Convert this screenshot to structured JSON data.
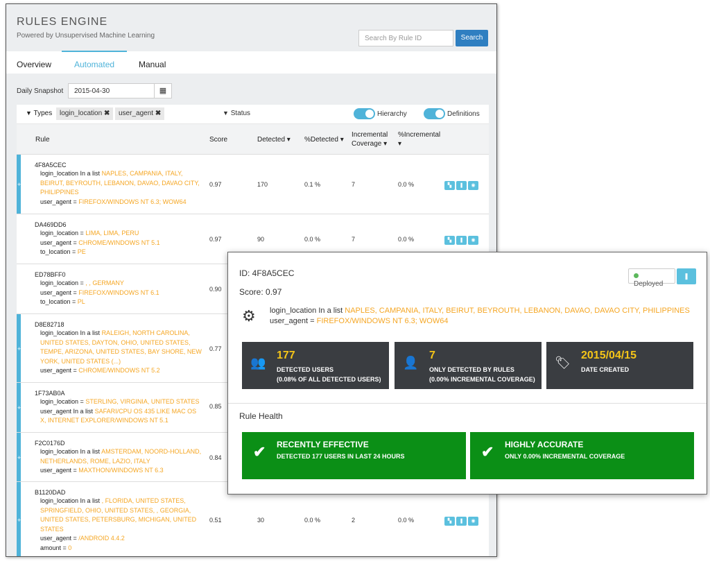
{
  "header": {
    "title": "RULES ENGINE",
    "subtitle": "Powered by Unsupervised Machine Learning",
    "search_placeholder": "Search By Rule ID",
    "search_button": "Search"
  },
  "tabs": [
    "Overview",
    "Automated",
    "Manual"
  ],
  "snapshot": {
    "label": "Daily Snapshot",
    "date": "2015-04-30"
  },
  "filters": {
    "types_label": "Types",
    "chips": [
      "login_location",
      "user_agent"
    ],
    "status_label": "Status",
    "toggle1": "Hierarchy",
    "toggle2": "Definitions"
  },
  "columns": {
    "rule": "Rule",
    "score": "Score",
    "detected": "Detected",
    "pct_detected": "%Detected",
    "inc_cov_1": "Incremental",
    "inc_cov_2": "Coverage",
    "pct_inc": "%Incremental"
  },
  "rows": [
    {
      "id": "4F8A5CEC",
      "score": "0.97",
      "detected": "170",
      "pct": "0.1 %",
      "inc": "7",
      "pinc": "0.0 %"
    },
    {
      "id": "DA469DD6",
      "score": "0.97",
      "detected": "90",
      "pct": "0.0 %",
      "inc": "7",
      "pinc": "0.0 %"
    },
    {
      "id": "ED78BFF0",
      "score": "0.90"
    },
    {
      "id": "D8E82718",
      "score": "0.77"
    },
    {
      "id": "1F73AB0A",
      "score": "0.85"
    },
    {
      "id": "F2C0176D",
      "score": "0.84"
    },
    {
      "id": "B1120DAD",
      "score": "0.51",
      "detected": "30",
      "pct": "0.0 %",
      "inc": "2",
      "pinc": "0.0 %"
    }
  ],
  "popup": {
    "id": "ID: 4F8A5CEC",
    "score": "Score: 0.97",
    "deployed": "Deployed",
    "cond1_key": "login_location",
    "cond1_op": "In a list",
    "cond1_val": "NAPLES, CAMPANIA, ITALY, BEIRUT, BEYROUTH, LEBANON, DAVAO, DAVAO CITY, PHILIPPINES",
    "cond2_key": "user_agent",
    "cond2_op": "=",
    "cond2_val": "FIREFOX/WINDOWS NT 6.3; WOW64",
    "stats": [
      {
        "num": "177",
        "l1": "DETECTED USERS",
        "l2": "(0.08% OF ALL DETECTED USERS)"
      },
      {
        "num": "7",
        "l1": "ONLY DETECTED BY RULES",
        "l2": "(0.00% INCREMENTAL COVERAGE)"
      },
      {
        "num": "2015/04/15",
        "l1": "DATE CREATED",
        "l2": ""
      }
    ],
    "health_title": "Rule Health",
    "health": [
      {
        "title": "RECENTLY EFFECTIVE",
        "sub": "DETECTED 177 USERS IN LAST 24 HOURS"
      },
      {
        "title": "HIGHLY ACCURATE",
        "sub": "ONLY 0.00% INCREMENTAL COVERAGE"
      }
    ]
  },
  "colors": {
    "accent": "#4fb3d9",
    "orange": "#f5a623",
    "green": "#0b8f16",
    "dark": "#3a3d41"
  }
}
